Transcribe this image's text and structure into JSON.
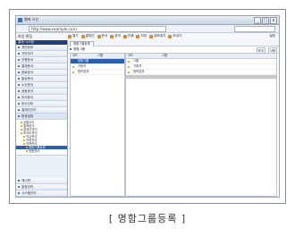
{
  "window": {
    "title": "웹에 오신",
    "address": "http://www.example.co.kr",
    "search": "",
    "controls": [
      "_",
      "□",
      "x"
    ]
  },
  "menubar": {
    "label": "파일 편집",
    "tools": [
      "열기",
      "결재선",
      "문서",
      "검색",
      "인쇄",
      "저장",
      "내보내기",
      "보내기"
    ],
    "help": "설정"
  },
  "sidebar": {
    "header": "결재 시스템",
    "items": [
      "개인정보",
      "기안하기",
      "진행문서",
      "결재문서",
      "완료문서",
      "발송문서",
      "수신문서",
      "공람문서",
      "부서문서",
      "문서관리",
      "결재선관리",
      "환경설정"
    ],
    "tree": [
      {
        "level": 1,
        "label": "공통코드"
      },
      {
        "level": 1,
        "label": "결재양식"
      },
      {
        "level": 1,
        "label": "결재선관리"
      },
      {
        "level": 1,
        "label": "조직도관리"
      },
      {
        "level": 2,
        "label": "직급관리"
      },
      {
        "level": 2,
        "label": "직위관리"
      },
      {
        "level": 2,
        "label": "직책관리"
      },
      {
        "level": 3,
        "label": "명함그룹등록"
      },
      {
        "level": 3,
        "label": "명함관리"
      }
    ],
    "bottom": [
      "게시판",
      "일정관리",
      "시스템관리"
    ]
  },
  "content": {
    "tab": "명함그룹등록",
    "caption": "명함그룹",
    "buttons": [
      "추가",
      "삭제"
    ],
    "left": {
      "headers": [
        "코드",
        "그룹"
      ],
      "rows": [
        "명함그룹",
        "거래처",
        "협력업체"
      ]
    },
    "right": {
      "headers": [
        "코드",
        "그룹"
      ],
      "rows": [
        "그룹",
        "거래처",
        "협력업체"
      ]
    }
  },
  "caption": "[ 명함그룹등록 ]"
}
